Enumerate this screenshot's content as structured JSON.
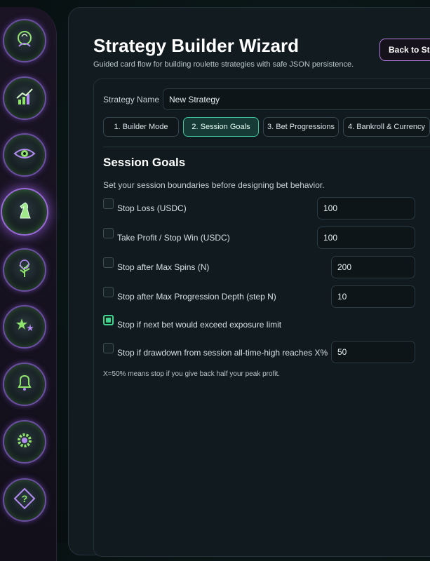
{
  "sidebar": {
    "items": [
      {
        "icon": "leaf-head-icon",
        "active": false
      },
      {
        "icon": "growth-chart-icon",
        "active": false
      },
      {
        "icon": "eye-icon",
        "active": false
      },
      {
        "icon": "chess-knight-icon",
        "active": true
      },
      {
        "icon": "tree-icon",
        "active": false
      },
      {
        "icon": "stars-icon",
        "active": false
      },
      {
        "icon": "bell-icon",
        "active": false
      },
      {
        "icon": "gear-icon",
        "active": false
      },
      {
        "icon": "question-diamond-icon",
        "active": false
      }
    ]
  },
  "header": {
    "title": "Strategy Builder Wizard",
    "subtitle": "Guided card flow for building roulette strategies with safe JSON persistence.",
    "back_label": "Back to Str"
  },
  "form": {
    "name_label": "Strategy Name",
    "name_value": "New Strategy"
  },
  "tabs": [
    {
      "label": "1. Builder Mode",
      "active": false
    },
    {
      "label": "2. Session Goals",
      "active": true
    },
    {
      "label": "3. Bet Progressions",
      "active": false
    },
    {
      "label": "4. Bankroll & Currency",
      "active": false
    }
  ],
  "section": {
    "title": "Session Goals",
    "description": "Set your session boundaries before designing bet behavior.",
    "hint": "X=50% means stop if you give back half your peak profit."
  },
  "goals": [
    {
      "label": "Stop Loss (USDC)",
      "checked": false,
      "value": "100"
    },
    {
      "label": "Take Profit / Stop Win (USDC)",
      "checked": false,
      "value": "100"
    },
    {
      "label": "Stop after Max Spins (N)",
      "checked": false,
      "value": "200"
    },
    {
      "label": "Stop after Max Progression Depth (step N)",
      "checked": false,
      "value": "10"
    },
    {
      "label": "Stop if next bet would exceed exposure limit",
      "checked": true
    },
    {
      "label": "Stop if drawdown from session all-time-high reaches X%",
      "checked": false,
      "value": "50"
    }
  ],
  "colors": {
    "accent_green": "#3ed38e",
    "accent_purple": "#b37fe0",
    "panel_bg": "#121b20"
  }
}
